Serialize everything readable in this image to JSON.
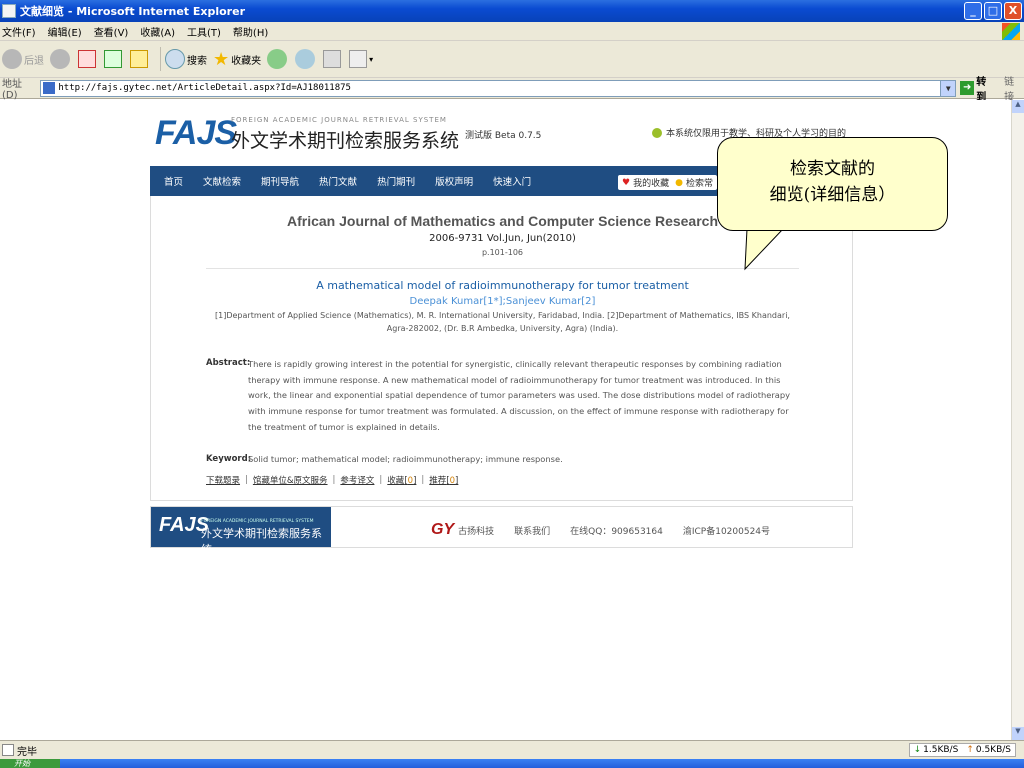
{
  "window": {
    "title": "文献细览 - Microsoft Internet Explorer",
    "buttons": [
      "_",
      "□",
      "X"
    ]
  },
  "menubar": {
    "items": [
      "文件(F)",
      "编辑(E)",
      "查看(V)",
      "收藏(A)",
      "工具(T)",
      "帮助(H)"
    ]
  },
  "toolbar": {
    "back": "后退",
    "search": "搜索",
    "favorites": "收藏夹"
  },
  "addressbar": {
    "label": "地址(D)",
    "url": "http://fajs.gytec.net/ArticleDetail.aspx?Id=AJ18011875",
    "go": "转到",
    "links": "链接"
  },
  "site": {
    "logo": "FAJS",
    "logo_sub": "FOREIGN ACADEMIC JOURNAL RETRIEVAL SYSTEM",
    "logo_cn": "外文学术期刊检索服务系统",
    "beta": "测试版 Beta 0.7.5",
    "notice": "本系统仅限用于教学、科研及个人学习的目的"
  },
  "nav": {
    "items": [
      "首页",
      "文献检索",
      "期刊导航",
      "热门文献",
      "热门期刊",
      "版权声明",
      "快速入门"
    ],
    "my_favorites": "我的收藏",
    "search_tip": "检索常"
  },
  "article": {
    "journal": "African Journal of Mathematics and Computer Science Research",
    "issn": "2006-9731 Vol.Jun, Jun(2010)",
    "pages": "p.101-106",
    "title": "A mathematical model of radioimmunotherapy for tumor treatment",
    "authors": "Deepak Kumar[1*];Sanjeev Kumar[2]",
    "affiliation": "[1]Department of Applied Science (Mathematics), M. R. International University, Faridabad, India. [2]Department of Mathematics, IBS Khandari, Agra-282002, (Dr. B.R Ambedka, University, Agra) (India).",
    "abstract_label": "Abstract:",
    "abstract": "There is rapidly growing interest in the potential for synergistic, clinically relevant therapeutic responses by combining radiation therapy with immune response. A new mathematical model of radioimmunotherapy for tumor treatment was introduced. In this work, the linear and exponential spatial dependence of tumor parameters was used. The dose distributions model of radiotherapy with immune response for tumor treatment was formulated. A discussion, on the effect of immune response with radiotherapy for the treatment of tumor is explained in details.",
    "keyword_label": "Keyword:",
    "keywords": "Solid tumor; mathematical model; radioimmunotherapy; immune response."
  },
  "actions": {
    "download": "下载题录",
    "library": "馆藏单位&原文服务",
    "reference": "参考译文",
    "collect": "收藏",
    "collect_count": "0",
    "recommend": "推荐",
    "recommend_count": "0"
  },
  "footer": {
    "logo": "FAJS",
    "logo_sub": "FOREIGN ACADEMIC JOURNAL RETRIEVAL SYSTEM",
    "logo_cn": "外文学术期刊检索服务系统",
    "brand_mark": "GY",
    "brand": "古扬科技",
    "contact": "联系我们",
    "qq": "在线QQ：909653164",
    "icp": "渝ICP备10200524号"
  },
  "callout": {
    "line1": "检索文献的",
    "line2": "细览(详细信息）"
  },
  "statusbar": {
    "text": "完毕",
    "down": "1.5KB/S",
    "up": "0.5KB/S"
  },
  "taskbar": {
    "start": "开始"
  },
  "colors": {
    "nav_bg": "#1f4d82",
    "logo_blue": "#1b5fa6",
    "link_blue": "#4a90d6",
    "callout_bg": "#ffffcc"
  }
}
